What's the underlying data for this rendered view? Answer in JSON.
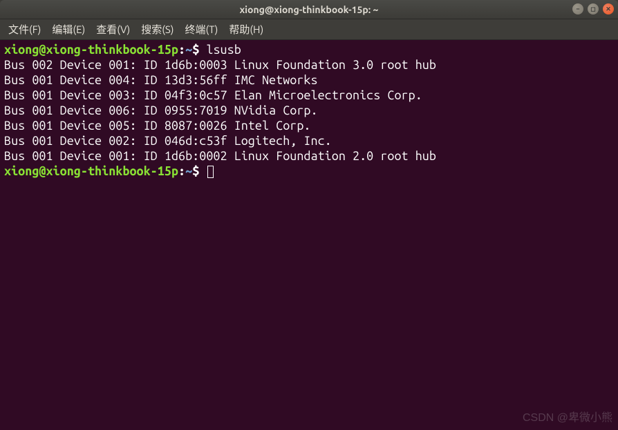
{
  "titlebar": {
    "title": "xiong@xiong-thinkbook-15p: ~"
  },
  "menu": {
    "file": "文件(F)",
    "edit": "编辑(E)",
    "view": "查看(V)",
    "search": "搜索(S)",
    "terminal": "终端(T)",
    "help": "帮助(H)"
  },
  "prompt": {
    "userhost": "xiong@xiong-thinkbook-15p",
    "sep": ":",
    "path": "~",
    "symbol": "$"
  },
  "commands": {
    "first": "lsusb",
    "second": ""
  },
  "output_lines": [
    "Bus 002 Device 001: ID 1d6b:0003 Linux Foundation 3.0 root hub",
    "Bus 001 Device 004: ID 13d3:56ff IMC Networks",
    "Bus 001 Device 003: ID 04f3:0c57 Elan Microelectronics Corp.",
    "Bus 001 Device 006: ID 0955:7019 NVidia Corp.",
    "Bus 001 Device 005: ID 8087:0026 Intel Corp.",
    "Bus 001 Device 002: ID 046d:c53f Logitech, Inc.",
    "Bus 001 Device 001: ID 1d6b:0002 Linux Foundation 2.0 root hub"
  ],
  "watermark": "CSDN @卑微小熊"
}
